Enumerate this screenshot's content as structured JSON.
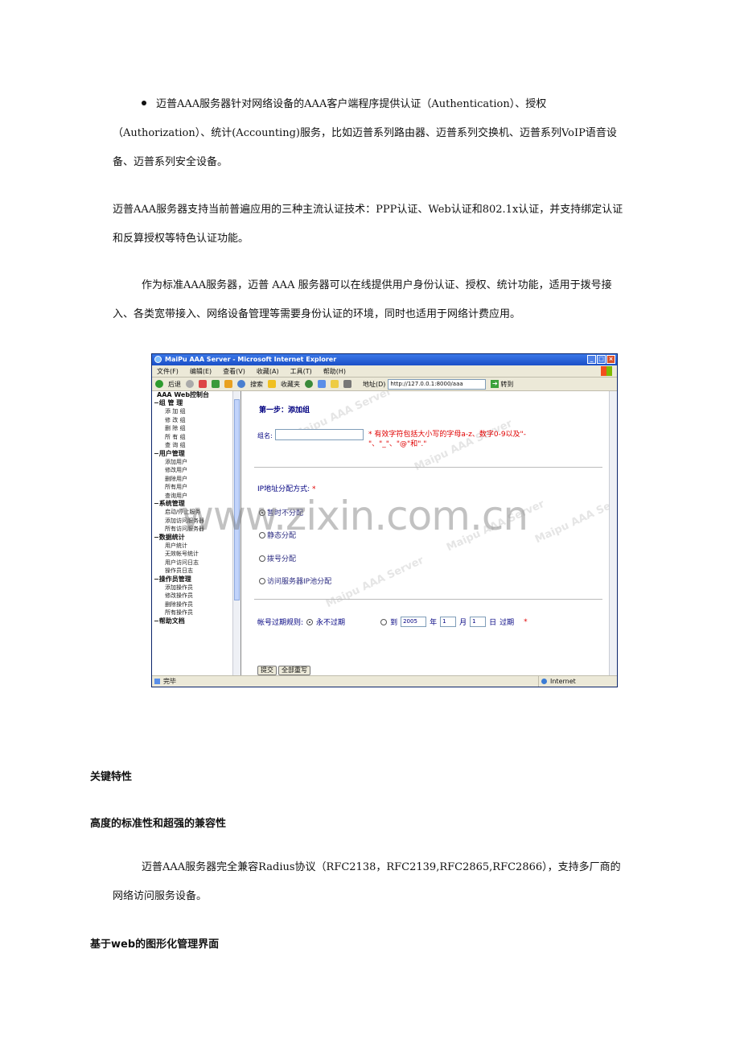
{
  "intro": {
    "bullet_text": "迈普AAA服务器针对网络设备的AAA客户端程序提供认证（Authentication）、授权（Authorization）、统计(Accounting)服务，比如迈普系列路由器、迈普系列交换机、迈普系列VoIP语音设备、迈普系列安全设备。",
    "para2": "迈普AAA服务器支持当前普遍应用的三种主流认证技术：PPP认证、Web认证和802.1x认证，并支持绑定认证和反算授权等特色认证功能。",
    "para3": "作为标准AAA服务器，迈普 AAA 服务器可以在线提供用户身份认证、授权、统计功能，适用于拨号接入、各类宽带接入、网络设备管理等需要身份认证的环境，同时也适用于网络计费应用。"
  },
  "screenshot": {
    "window_title": "MaiPu AAA Server - Microsoft Internet Explorer",
    "menu": [
      "文件(F)",
      "编辑(E)",
      "查看(V)",
      "收藏(A)",
      "工具(T)",
      "帮助(H)"
    ],
    "toolbar": {
      "back": "后退",
      "search": "搜索",
      "favorites": "收藏夹",
      "address_label": "地址(D)",
      "address_value": "http://127.0.0.1:8000/aaa",
      "go": "转到"
    },
    "tree": {
      "root": "AAA Web控制台",
      "categories": [
        {
          "label": "组 管 理",
          "items": [
            "添 加 组",
            "修 改 组",
            "删 除 组",
            "所 有 组",
            "查 询 组"
          ]
        },
        {
          "label": "用户管理",
          "items": [
            "添加用户",
            "修改用户",
            "删除用户",
            "所有用户",
            "查询用户"
          ]
        },
        {
          "label": "系统管理",
          "items": [
            "启动/停止服务",
            "添加访问服务器",
            "所有访问服务器"
          ]
        },
        {
          "label": "数据统计",
          "items": [
            "用户统计",
            "无效帐号统计",
            "用户访问日志",
            "操作员日志"
          ]
        },
        {
          "label": "操作员管理",
          "items": [
            "添加操作员",
            "修改操作员",
            "删除操作员",
            "所有操作员"
          ]
        },
        {
          "label": "帮助文档",
          "items": []
        }
      ]
    },
    "form": {
      "step_title": "第一步：添加组",
      "group_name_label": "组名:",
      "group_name_note": "* 有效字符包括大小写的字母a-z、数字0-9以及\"-\"、\"_\"、\"@\"和\".\"",
      "ip_label": "IP地址分配方式:",
      "required_mark": "*",
      "ip_options": [
        "暂时不分配",
        "静态分配",
        "拨号分配",
        "访问服务器IP池分配"
      ],
      "expiry_label": "帐号过期规则:",
      "expiry_never": "永不过期",
      "expiry_until": "到",
      "year": "2005",
      "year_unit": "年",
      "month": "1",
      "month_unit": "月",
      "day": "1",
      "day_unit": "日",
      "expire_word": "过期",
      "submit": "提交",
      "reset": "全部重写"
    },
    "status": {
      "done": "完毕",
      "zone": "Internet"
    },
    "watermark": "Maipu AAA Server"
  },
  "watermark_big": "www.zixin.com.cn",
  "key_features": "关键特性",
  "section1": {
    "title": "高度的标准性和超强的兼容性",
    "body": "迈普AAA服务器完全兼容Radius协议（RFC2138，RFC2139,RFC2865,RFC2866），支持多厂商的网络访问服务设备。"
  },
  "section2": {
    "title": "基于web的图形化管理界面"
  }
}
